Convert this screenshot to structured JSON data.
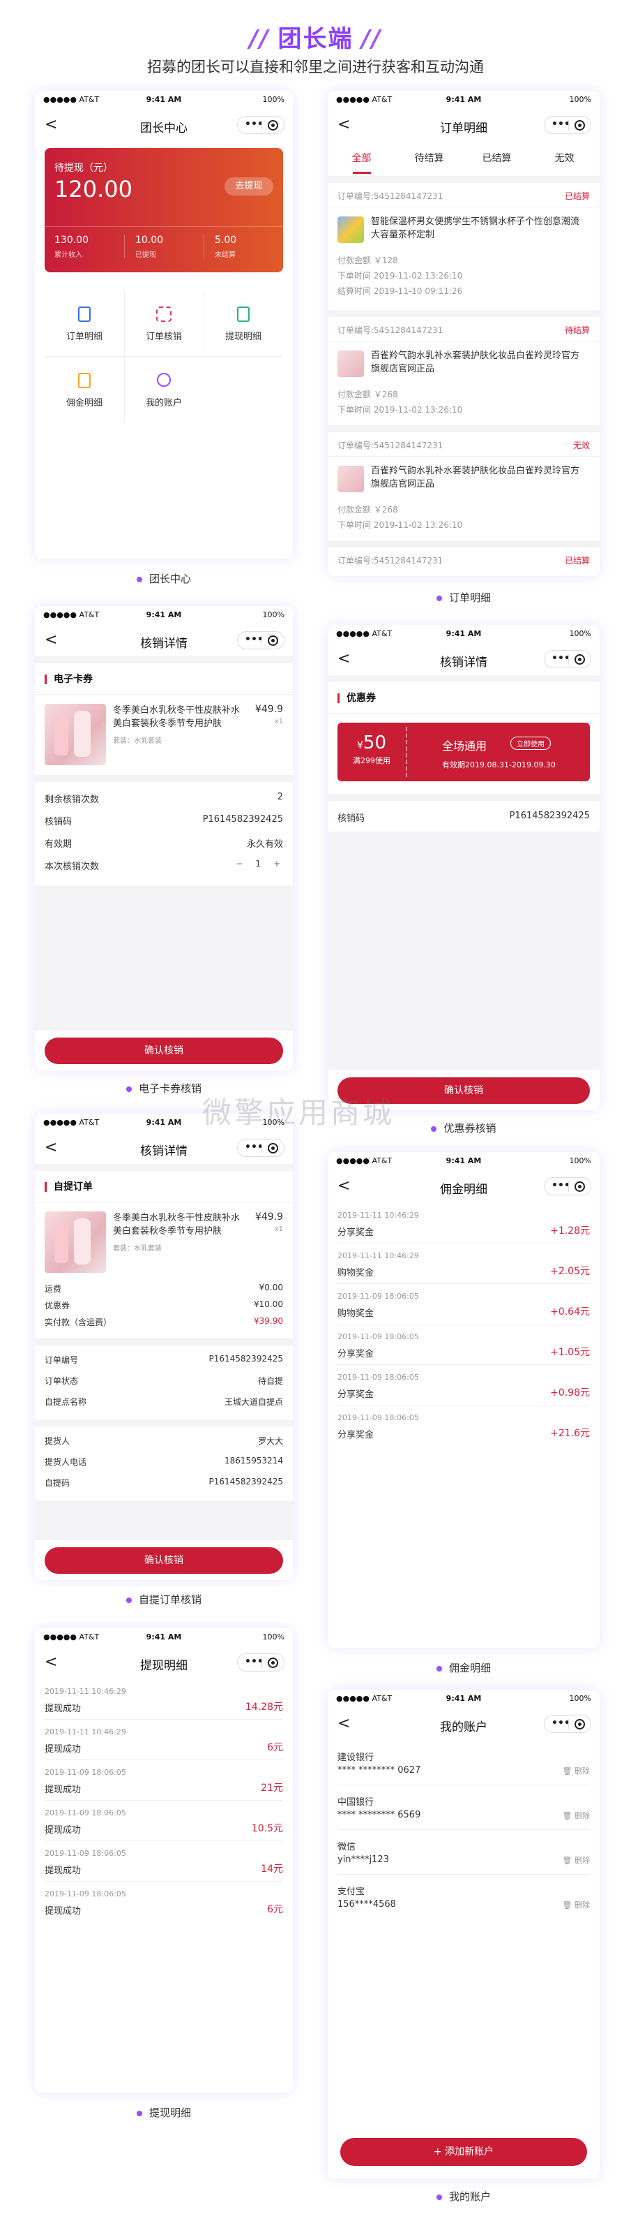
{
  "header": {
    "title": "团长端",
    "subtitle": "招募的团长可以直接和邻里之间进行获客和互动沟通"
  },
  "status": {
    "carrier": "●●●●● AT&T",
    "time": "9:41 AM",
    "battery": "100%"
  },
  "watermark": "微擎应用商城",
  "nav_back": "<",
  "capsule_dots": "•••",
  "p1": {
    "title": "团长中心",
    "caption": "团长中心",
    "balance_label": "待提现（元）",
    "balance": "120.00",
    "withdraw_btn": "去提现",
    "stats": [
      {
        "value": "130.00",
        "label": "累计收入"
      },
      {
        "value": "10.00",
        "label": "已提现"
      },
      {
        "value": "5.00",
        "label": "未结算"
      }
    ],
    "menu": [
      {
        "label": "订单明细",
        "icon": "order-list-icon"
      },
      {
        "label": "订单核销",
        "icon": "scan-verify-icon"
      },
      {
        "label": "提现明细",
        "icon": "withdraw-detail-icon"
      },
      {
        "label": "佣金明细",
        "icon": "commission-icon"
      },
      {
        "label": "我的账户",
        "icon": "account-icon"
      }
    ]
  },
  "p2": {
    "title": "订单明细",
    "caption": "订单明细",
    "tabs": [
      "全部",
      "待结算",
      "已结算",
      "无效"
    ],
    "orders": [
      {
        "no": "订单编号:5451284147231",
        "status": "已结算",
        "name": "智能保温杯男女便携学生不锈钢水杯子个性创意潮流大容量茶杯定制",
        "amount": "付款金额  ￥128",
        "order_time": "下单时间  2019-11-02 13:26:10",
        "settle_time": "结算时间  2019-11-10 09:11:26"
      },
      {
        "no": "订单编号:5451284147231",
        "status": "待结算",
        "name": "百雀羚气韵水乳补水套装护肤化妆品白雀羚灵玲官方旗舰店官网正品",
        "amount": "付款金额  ￥268",
        "order_time": "下单时间  2019-11-02 13:26:10"
      },
      {
        "no": "订单编号:5451284147231",
        "status": "无效",
        "name": "百雀羚气韵水乳补水套装护肤化妆品白雀羚灵玲官方旗舰店官网正品",
        "amount": "付款金额  ￥268",
        "order_time": "下单时间  2019-11-02 13:26:10"
      },
      {
        "no": "订单编号:5451284147231",
        "status": "已结算"
      }
    ]
  },
  "p3": {
    "title": "核销详情",
    "caption": "电子卡券核销",
    "section": "电子卡券",
    "product": "冬季美白水乳秋冬干性皮肤补水美白套装秋冬季节专用护肤",
    "price": "¥49.9",
    "qty": "x1",
    "spec": "套装：水乳套装",
    "rows": [
      {
        "label": "剩余核销次数",
        "value": "2"
      },
      {
        "label": "核销码",
        "value": "P1614582392425"
      },
      {
        "label": "有效期",
        "value": "永久有效"
      },
      {
        "label": "本次核销次数",
        "value": "1"
      }
    ],
    "stepper_minus": "−",
    "stepper_plus": "+",
    "button": "确认核销"
  },
  "p4": {
    "title": "核销详情",
    "caption": "优惠券核销",
    "section": "优惠券",
    "coupon_amount": "50",
    "coupon_currency": "¥",
    "coupon_cond": "满299使用",
    "coupon_name": "全场通用",
    "coupon_tag": "立即使用",
    "coupon_valid": "有效期2019.08.31-2019.09.30",
    "code_label": "核销码",
    "code_value": "P1614582392425",
    "button": "确认核销"
  },
  "p5": {
    "title": "核销详情",
    "caption": "自提订单核销",
    "section": "自提订单",
    "product": "冬季美白水乳秋冬干性皮肤补水美白套装秋冬季节专用护肤",
    "price": "¥49.9",
    "qty": "x1",
    "spec": "套装：水乳套装",
    "fee_rows": [
      {
        "label": "运费",
        "value": "¥0.00"
      },
      {
        "label": "优惠券",
        "value": "¥10.00"
      },
      {
        "label": "实付款（含运费）",
        "value": "¥39.90"
      }
    ],
    "order_rows": [
      {
        "label": "订单编号",
        "value": "P1614582392425"
      },
      {
        "label": "订单状态",
        "value": "待自提"
      },
      {
        "label": "自提点名称",
        "value": "王城大道自提点"
      }
    ],
    "pick_rows": [
      {
        "label": "提货人",
        "value": "罗大大"
      },
      {
        "label": "提货人电话",
        "value": "18615953214"
      },
      {
        "label": "自提码",
        "value": "P1614582392425"
      }
    ],
    "button": "确认核销"
  },
  "p6": {
    "title": "佣金明细",
    "caption": "佣金明细",
    "items": [
      {
        "time": "2019-11-11 10:46:29",
        "label": "分享奖金",
        "value": "+1.28元"
      },
      {
        "time": "2019-11-11 10:46:29",
        "label": "购物奖金",
        "value": "+2.05元"
      },
      {
        "time": "2019-11-09 18:06:05",
        "label": "购物奖金",
        "value": "+0.64元"
      },
      {
        "time": "2019-11-09 18:06:05",
        "label": "分享奖金",
        "value": "+1.05元"
      },
      {
        "time": "2019-11-09 18:06:05",
        "label": "分享奖金",
        "value": "+0.98元"
      },
      {
        "time": "2019-11-09 18:06:05",
        "label": "分享奖金",
        "value": "+21.6元"
      }
    ]
  },
  "p7": {
    "title": "提现明细",
    "caption": "提现明细",
    "items": [
      {
        "time": "2019-11-11 10:46:29",
        "label": "提现成功",
        "value": "14.28元"
      },
      {
        "time": "2019-11-11 10:46:29",
        "label": "提现成功",
        "value": "6元"
      },
      {
        "time": "2019-11-09 18:06:05",
        "label": "提现成功",
        "value": "21元"
      },
      {
        "time": "2019-11-09 18:06:05",
        "label": "提现成功",
        "value": "10.5元"
      },
      {
        "time": "2019-11-09 18:06:05",
        "label": "提现成功",
        "value": "14元"
      },
      {
        "time": "2019-11-09 18:06:05",
        "label": "提现成功",
        "value": "6元"
      }
    ]
  },
  "p8": {
    "title": "我的账户",
    "caption": "我的账户",
    "accounts": [
      {
        "name": "建设银行",
        "number": "**** ******** 0627"
      },
      {
        "name": "中国银行",
        "number": "**** ******** 6569"
      },
      {
        "name": "微信",
        "number": "yin****j123"
      },
      {
        "name": "支付宝",
        "number": "156****4568"
      }
    ],
    "delete_label": "删除",
    "add_button": "+ 添加新账户"
  }
}
